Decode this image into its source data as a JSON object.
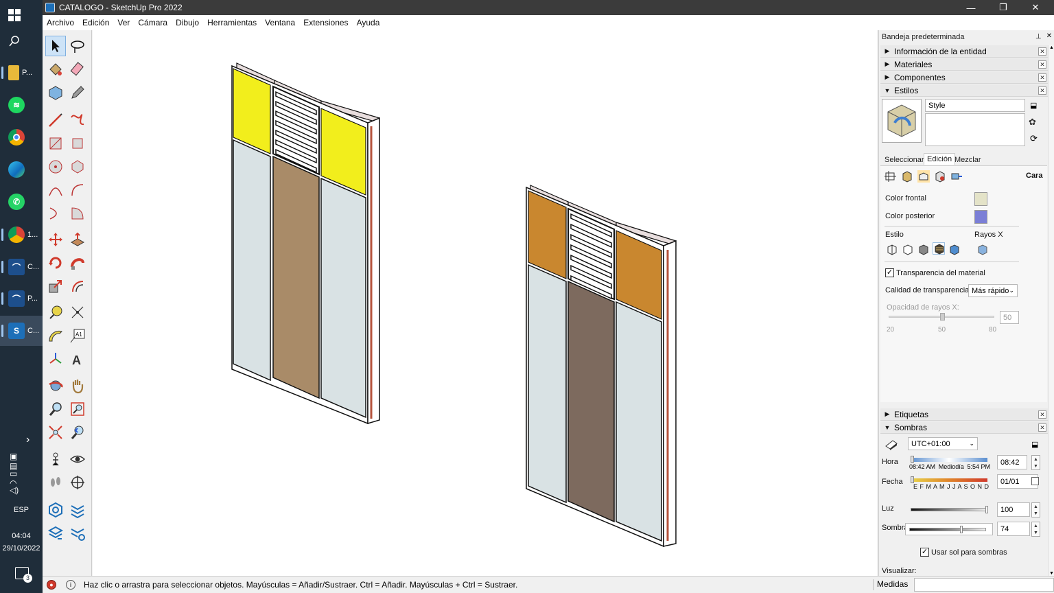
{
  "window": {
    "title": "CATALOGO - SketchUp Pro 2022"
  },
  "menu": [
    "Archivo",
    "Edición",
    "Ver",
    "Cámara",
    "Dibujo",
    "Herramientas",
    "Ventana",
    "Extensiones",
    "Ayuda"
  ],
  "taskbar": {
    "items": [
      {
        "label": "P..."
      },
      {
        "label": ""
      },
      {
        "label": ""
      },
      {
        "label": ""
      },
      {
        "label": ""
      },
      {
        "label": "1..."
      },
      {
        "label": "C..."
      },
      {
        "label": "P..."
      },
      {
        "label": "C..."
      }
    ],
    "language": "ESP",
    "time": "04:04",
    "date": "29/10/2022",
    "notification_count": "3"
  },
  "tray": {
    "header": "Bandeja predeterminada",
    "sections": {
      "entity_info": "Información de la entidad",
      "materials": "Materiales",
      "components": "Componentes",
      "styles": "Estilos",
      "tags": "Etiquetas",
      "shadows": "Sombras"
    },
    "styles_panel": {
      "style_name": "Style",
      "tabs": [
        "Seleccionar",
        "Edición",
        "Mezclar"
      ],
      "section_label": "Cara",
      "front_color_label": "Color frontal",
      "back_color_label": "Color posterior",
      "front_color": "#e4e3c8",
      "back_color": "#7b7fd6",
      "style_label": "Estilo",
      "xray_label": "Rayos X",
      "transparency_label": "Transparencia del material",
      "transparency_checked": "✓",
      "quality_label": "Calidad de transparencia:",
      "quality_value": "Más rápido",
      "xray_opacity_label": "Opacidad de rayos X:",
      "xray_opacity_value": "50",
      "slider_ticks": [
        "20",
        "50",
        "80"
      ],
      "xray_opacity": 50
    },
    "shadows_panel": {
      "timezone": "UTC+01:00",
      "hour_label": "Hora",
      "hour_value": "08:42",
      "hour_scale": [
        "08:42 AM",
        "Mediodía",
        "5:54 PM"
      ],
      "date_label": "Fecha",
      "date_value": "01/01",
      "months": "E F M A M J J A S O N D",
      "light_label": "Luz",
      "light_value": "100",
      "shade_label": "Sombra",
      "shade_value": "74",
      "use_sun_label": "Usar sol para sombras",
      "use_sun_checked": "✓",
      "visualize_label": "Visualizar:",
      "light": 100,
      "shade": 74
    }
  },
  "status": {
    "message": "Haz clic o arrastra para seleccionar objetos. Mayúsculas = Añadir/Sustraer. Ctrl = Añadir. Mayúsculas + Ctrl = Sustraer.",
    "measures_label": "Medidas"
  },
  "colors": {
    "panel_yellow": "#f2ee1c",
    "panel_orange": "#c9872f",
    "panel_wood": "#a98b68",
    "panel_dark": "#7d6a5e",
    "glass": "#d9e2e4"
  }
}
